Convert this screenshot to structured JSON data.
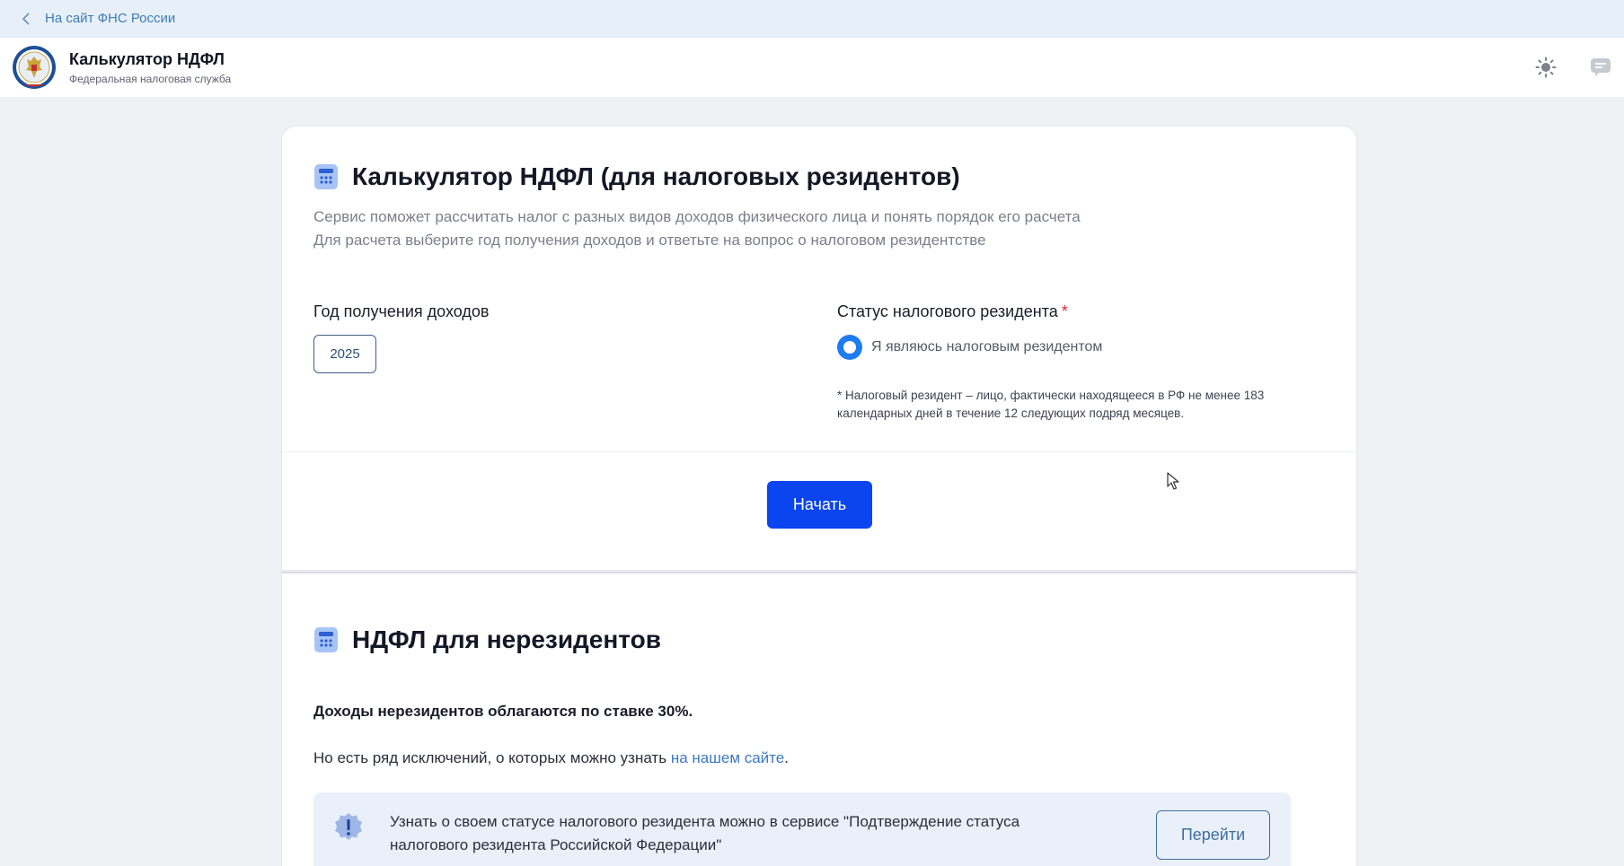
{
  "topbar": {
    "back_link": "На сайт ФНС России"
  },
  "header": {
    "title": "Калькулятор НДФЛ",
    "subtitle": "Федеральная налоговая служба"
  },
  "calculator": {
    "title": "Калькулятор НДФЛ (для налоговых резидентов)",
    "description_line1": "Сервис поможет рассчитать налог с разных видов доходов физического лица и понять порядок его расчета",
    "description_line2": "Для расчета выберите год получения доходов и ответьте на вопрос о налоговом резидентстве",
    "year_label": "Год получения доходов",
    "year_value": "2025",
    "status_label": "Статус налогового резидента",
    "required_mark": "*",
    "radio_option": "Я являюсь налоговым резидентом",
    "radio_selected": true,
    "note_line1": "* Налоговый резидент – лицо, фактически находящееся в РФ не менее 183",
    "note_line2": "календарных дней в течение 12 следующих подряд месяцев.",
    "start_button": "Начать"
  },
  "nonresident": {
    "title": "НДФЛ для нерезидентов",
    "rate_text": "Доходы нерезидентов облагаются по ставке 30%.",
    "exceptions_text": "Но есть ряд исключений, о которых можно узнать ",
    "exceptions_link": "на нашем сайте",
    "exceptions_tail": ".",
    "info_line1": "Узнать о своем статусе налогового резидента можно в сервисе \"Подтверждение статуса",
    "info_line2": "налогового резидента Российской Федерации\"",
    "go_button": "Перейти"
  },
  "colors": {
    "accent": "#0a45f0",
    "radio": "#1e7bf0",
    "link": "#3b78c2",
    "required": "#e0263c",
    "info_bg": "#e9f0fa"
  }
}
